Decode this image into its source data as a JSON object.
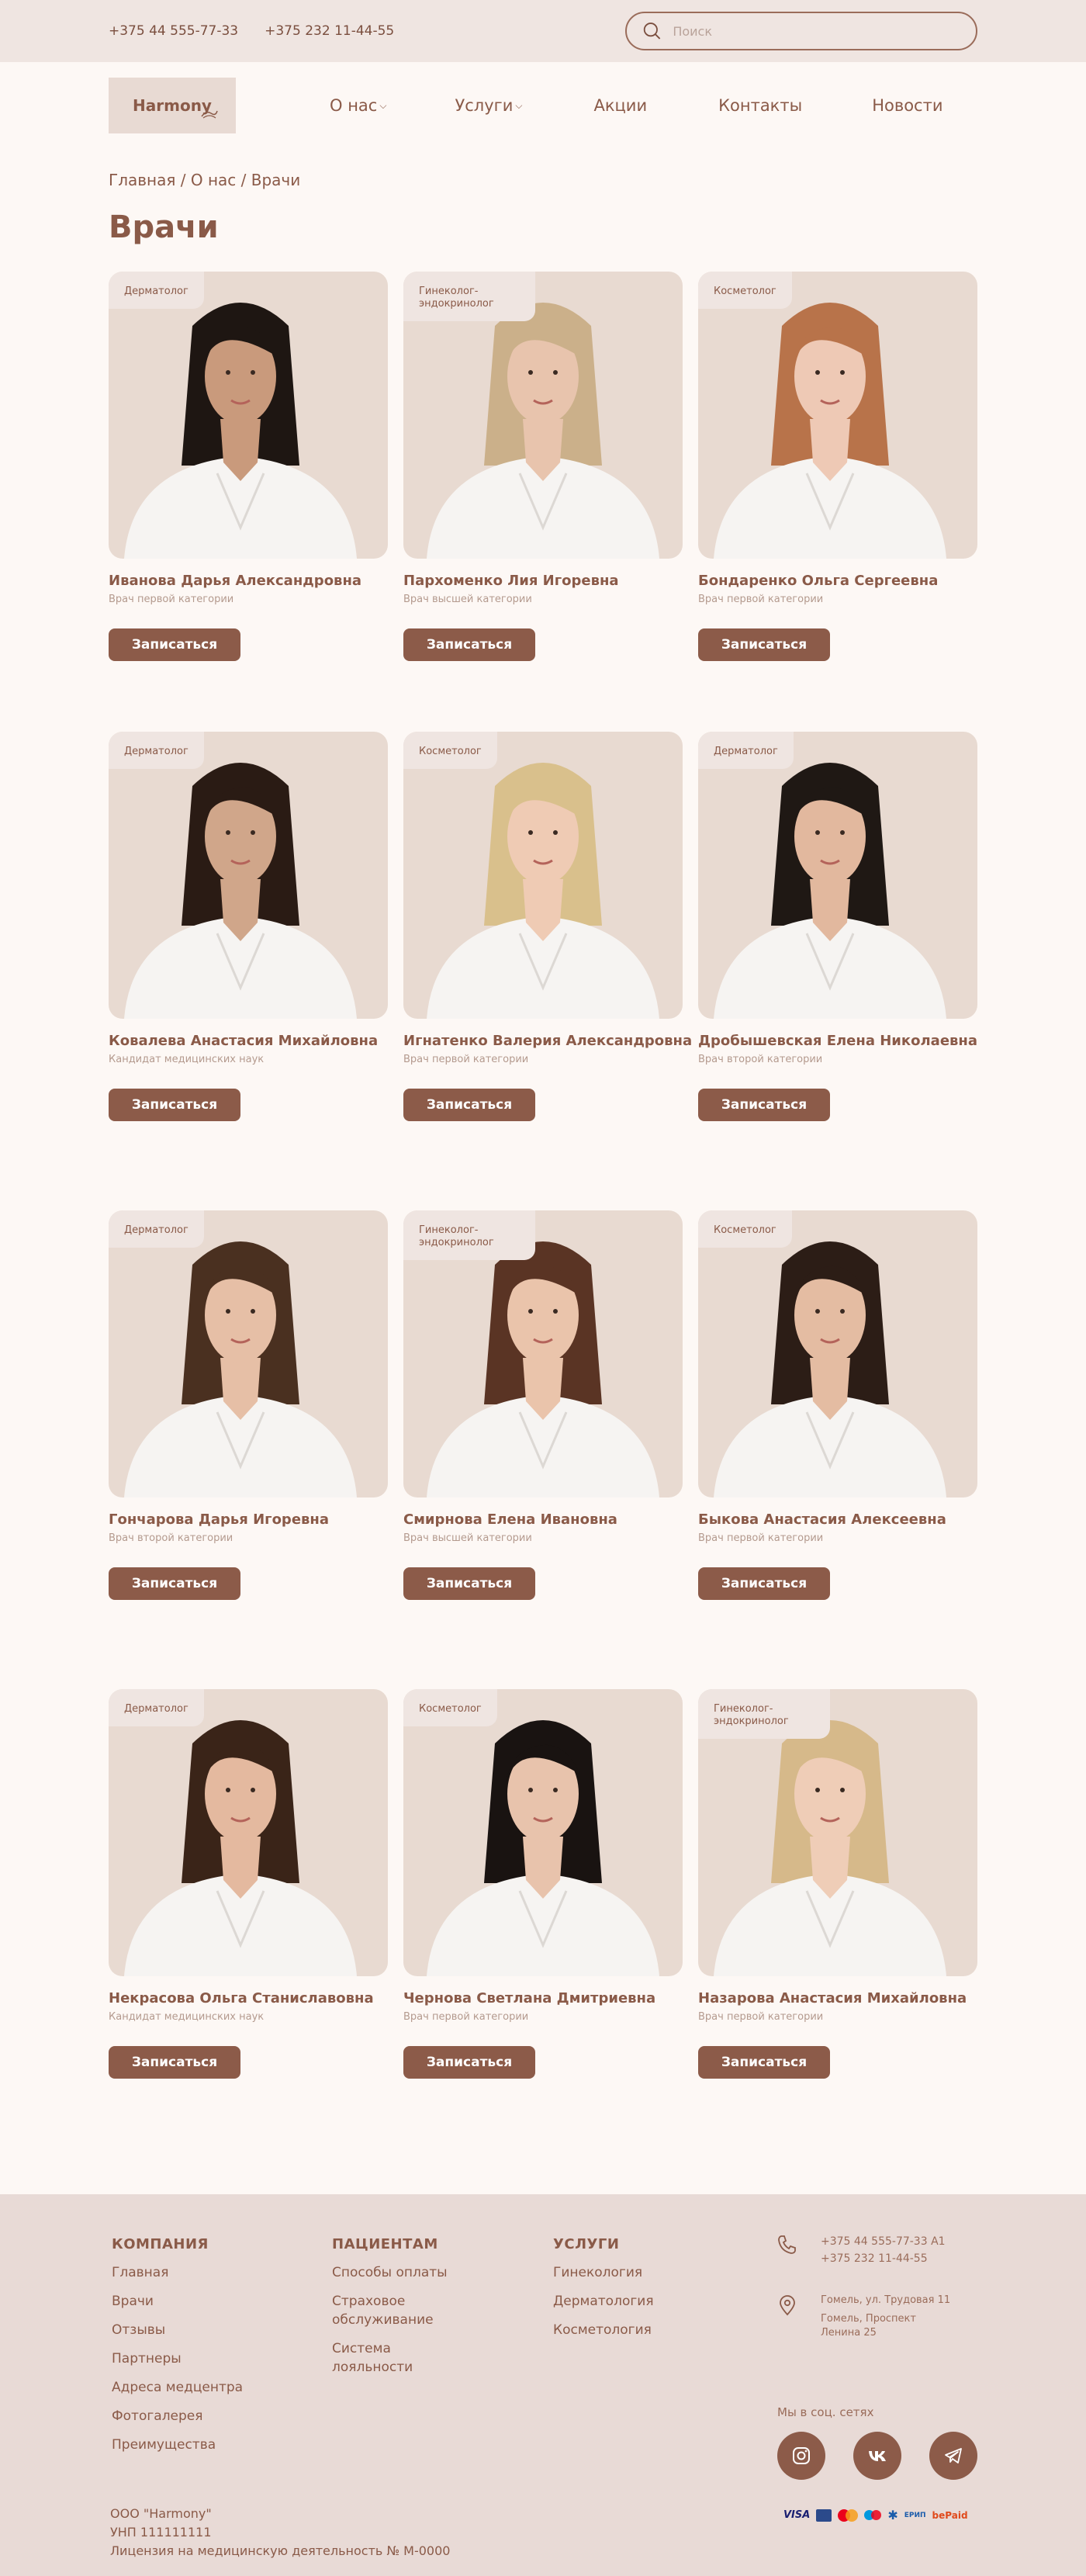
{
  "topbar": {
    "phone1": "+375 44 555-77-33",
    "phone2": "+375 232 11-44-55",
    "search_placeholder": "Поиск"
  },
  "logo": {
    "text": "Harmony"
  },
  "nav": {
    "items": [
      {
        "label": "О нас",
        "dropdown": true
      },
      {
        "label": "Услуги",
        "dropdown": true
      },
      {
        "label": "Акции",
        "dropdown": false
      },
      {
        "label": "Контакты",
        "dropdown": false
      },
      {
        "label": "Новости",
        "dropdown": false
      }
    ]
  },
  "breadcrumb": "Главная / О нас / Врачи",
  "page_title": "Врачи",
  "button_label": "Записаться",
  "doctors": [
    {
      "tag": "Дерматолог",
      "name": "Иванова Дарья Александровна",
      "category": "Врач первой категории",
      "hair": "#1e1612",
      "skin": "#c99a7c"
    },
    {
      "tag": "Гинеколог-эндокринолог",
      "name": "Пархоменко Лия Игоревна",
      "category": "Врач высшей категории",
      "hair": "#cbb08a",
      "skin": "#e8c4ad"
    },
    {
      "tag": "Косметолог",
      "name": "Бондаренко Ольга Сергеевна",
      "category": "Врач первой категории",
      "hair": "#b8734a",
      "skin": "#eec9b5"
    },
    {
      "tag": "Дерматолог",
      "name": "Ковалева Анастасия Михайловна",
      "category": "Кандидат медицинских наук",
      "hair": "#2a1b14",
      "skin": "#d0a68a"
    },
    {
      "tag": "Косметолог",
      "name": "Игнатенко Валерия Александровна",
      "category": "Врач первой категории",
      "hair": "#d9c08c",
      "skin": "#efcbb4"
    },
    {
      "tag": "Дерматолог",
      "name": "Дробышевская Елена Николаевна",
      "category": "Врач второй категории",
      "hair": "#1f1814",
      "skin": "#e2b89e"
    },
    {
      "tag": "Дерматолог",
      "name": "Гончарова Дарья Игоревна",
      "category": "Врач второй категории",
      "hair": "#4a3020",
      "skin": "#e6bfa6"
    },
    {
      "tag": "Гинеколог-эндокринолог",
      "name": "Смирнова Елена Ивановна",
      "category": "Врач высшей категории",
      "hair": "#5a3424",
      "skin": "#eac4ab"
    },
    {
      "tag": "Косметолог",
      "name": "Быкова Анастасия Алексеевна",
      "category": "Врач первой категории",
      "hair": "#2c1d16",
      "skin": "#e4bca2"
    },
    {
      "tag": "Дерматолог",
      "name": "Некрасова Ольга Станиславовна",
      "category": "Кандидат медицинских наук",
      "hair": "#3a2418",
      "skin": "#e4b99f"
    },
    {
      "tag": "Косметолог",
      "name": "Чернова Светлана Дмитриевна",
      "category": "Врач первой категории",
      "hair": "#191311",
      "skin": "#e8c3ac"
    },
    {
      "tag": "Гинеколог-эндокринолог",
      "name": "Назарова Анастасия Михайловна",
      "category": "Врач первой категории",
      "hair": "#d6b98a",
      "skin": "#efcdb7"
    }
  ],
  "footer": {
    "company": {
      "title": "КОМПАНИЯ",
      "links": [
        "Главная",
        "Врачи",
        "Отзывы",
        "Партнеры",
        "Адреса медцентра",
        "Фотогалерея",
        "Преимущества"
      ]
    },
    "patients": {
      "title": "ПАЦИЕНТАМ",
      "links": [
        "Способы оплаты",
        "Страховое обслуживание",
        "Система лояльности"
      ]
    },
    "services": {
      "title": "УСЛУГИ",
      "links": [
        "Гинекология",
        "Дерматология",
        "Косметология"
      ]
    },
    "phones": [
      "+375 44 555-77-33 A1",
      "+375 232 11-44-55"
    ],
    "address": [
      "Гомель, ул. Трудовая 11",
      "Гомель, Проспект Ленина 25"
    ],
    "social_title": "Мы в соц. сетях",
    "social_icons": [
      "instagram-icon",
      "vk-icon",
      "telegram-icon"
    ],
    "legal": [
      "ООО \"Harmony\"",
      "УНП 111111111",
      "Лицензия на медицинскую деятельность № М-0000"
    ],
    "payments": [
      "VISA",
      "Belkart",
      "Mastercard",
      "Maestro",
      "Apple",
      "ЕРИП",
      "БЕЛАРТ",
      "bePaid"
    ]
  },
  "colors": {
    "accent": "#8c5b49",
    "background": "#fdf8f5",
    "topbar": "#efe5e1",
    "card": "#e8dad1",
    "footer": "#e8dad6"
  }
}
